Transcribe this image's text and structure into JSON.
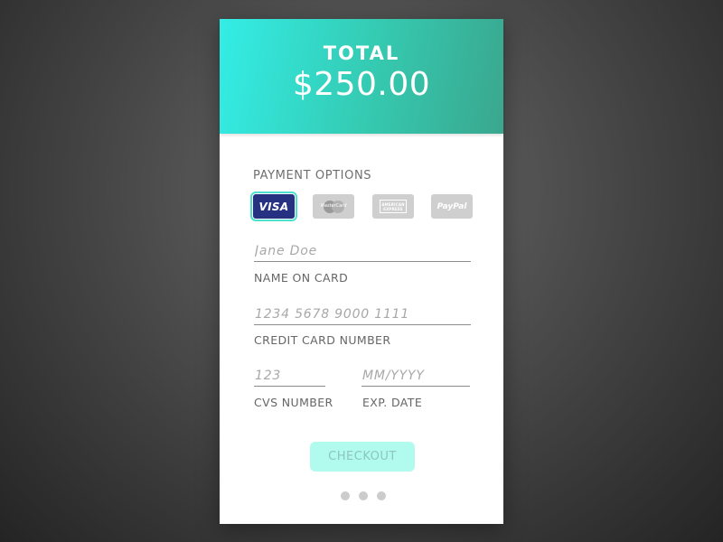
{
  "header": {
    "total_label": "TOTAL",
    "total_amount": "$250.00"
  },
  "payment": {
    "section_label": "PAYMENT OPTIONS",
    "options": [
      {
        "name": "VISA",
        "selected": true
      },
      {
        "name": "MasterCard",
        "selected": false
      },
      {
        "name": "AMERICAN EXPRESS",
        "selected": false
      },
      {
        "name": "PayPal",
        "selected": false
      }
    ],
    "visa_text": "VISA",
    "mastercard_text": "MasterCard",
    "amex_line1": "AMERICAN",
    "amex_line2": "EXPRESS",
    "paypal_text": "PayPal"
  },
  "form": {
    "name": {
      "placeholder": "Jane Doe",
      "value": "",
      "label": "NAME ON CARD"
    },
    "card": {
      "placeholder": "1234 5678 9000 1111",
      "value": "",
      "label": "CREDIT CARD NUMBER"
    },
    "cvs": {
      "placeholder": "123",
      "value": "",
      "label": "CVS NUMBER"
    },
    "exp": {
      "placeholder": "MM/YYYY",
      "value": "",
      "label": "EXP. DATE"
    }
  },
  "checkout_label": "CHECKOUT",
  "pagination": {
    "count": 3,
    "active_index": null
  },
  "colors": {
    "header_gradient_start": "#33ede6",
    "header_gradient_end": "#3aa78e",
    "visa_blue": "#263182",
    "selected_outline": "#4ee0cf",
    "checkout_bg": "#b0fbee",
    "checkout_text": "#8fc5bc"
  }
}
